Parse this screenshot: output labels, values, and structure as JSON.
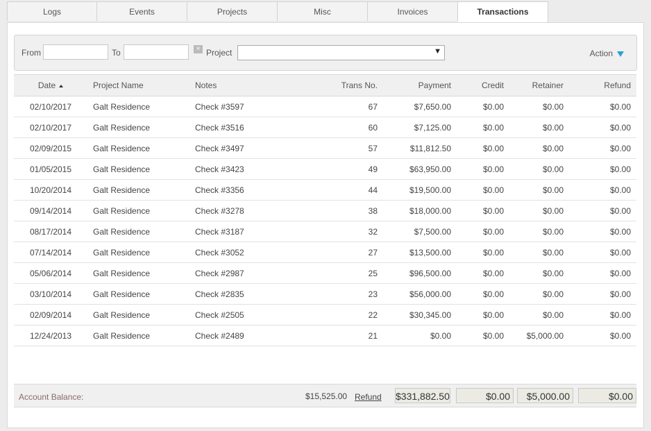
{
  "tabs": [
    {
      "label": "Logs"
    },
    {
      "label": "Events"
    },
    {
      "label": "Projects"
    },
    {
      "label": "Misc"
    },
    {
      "label": "Invoices"
    },
    {
      "label": "Transactions"
    }
  ],
  "filter": {
    "from_label": "From",
    "to_label": "To",
    "project_label": "Project",
    "from_value": "",
    "to_value": "",
    "project_value": "",
    "clear_glyph": "×",
    "action_label": "Action"
  },
  "columns": {
    "date": "Date",
    "project": "Project Name",
    "notes": "Notes",
    "trans": "Trans No.",
    "payment": "Payment",
    "credit": "Credit",
    "retainer": "Retainer",
    "refund": "Refund"
  },
  "rows": [
    {
      "date": "02/10/2017",
      "project": "Galt Residence",
      "notes": "Check #3597",
      "trans": "67",
      "payment": "$7,650.00",
      "credit": "$0.00",
      "retainer": "$0.00",
      "refund": "$0.00"
    },
    {
      "date": "02/10/2017",
      "project": "Galt Residence",
      "notes": "Check #3516",
      "trans": "60",
      "payment": "$7,125.00",
      "credit": "$0.00",
      "retainer": "$0.00",
      "refund": "$0.00"
    },
    {
      "date": "02/09/2015",
      "project": "Galt Residence",
      "notes": "Check #3497",
      "trans": "57",
      "payment": "$11,812.50",
      "credit": "$0.00",
      "retainer": "$0.00",
      "refund": "$0.00"
    },
    {
      "date": "01/05/2015",
      "project": "Galt Residence",
      "notes": "Check #3423",
      "trans": "49",
      "payment": "$63,950.00",
      "credit": "$0.00",
      "retainer": "$0.00",
      "refund": "$0.00"
    },
    {
      "date": "10/20/2014",
      "project": "Galt Residence",
      "notes": "Check #3356",
      "trans": "44",
      "payment": "$19,500.00",
      "credit": "$0.00",
      "retainer": "$0.00",
      "refund": "$0.00"
    },
    {
      "date": "09/14/2014",
      "project": "Galt Residence",
      "notes": "Check #3278",
      "trans": "38",
      "payment": "$18,000.00",
      "credit": "$0.00",
      "retainer": "$0.00",
      "refund": "$0.00"
    },
    {
      "date": "08/17/2014",
      "project": "Galt Residence",
      "notes": "Check #3187",
      "trans": "32",
      "payment": "$7,500.00",
      "credit": "$0.00",
      "retainer": "$0.00",
      "refund": "$0.00"
    },
    {
      "date": "07/14/2014",
      "project": "Galt Residence",
      "notes": "Check #3052",
      "trans": "27",
      "payment": "$13,500.00",
      "credit": "$0.00",
      "retainer": "$0.00",
      "refund": "$0.00"
    },
    {
      "date": "05/06/2014",
      "project": "Galt Residence",
      "notes": "Check #2987",
      "trans": "25",
      "payment": "$96,500.00",
      "credit": "$0.00",
      "retainer": "$0.00",
      "refund": "$0.00"
    },
    {
      "date": "03/10/2014",
      "project": "Galt Residence",
      "notes": "Check #2835",
      "trans": "23",
      "payment": "$56,000.00",
      "credit": "$0.00",
      "retainer": "$0.00",
      "refund": "$0.00"
    },
    {
      "date": "02/09/2014",
      "project": "Galt Residence",
      "notes": "Check #2505",
      "trans": "22",
      "payment": "$30,345.00",
      "credit": "$0.00",
      "retainer": "$0.00",
      "refund": "$0.00"
    },
    {
      "date": "12/24/2013",
      "project": "Galt Residence",
      "notes": "Check #2489",
      "trans": "21",
      "payment": "$0.00",
      "credit": "$0.00",
      "retainer": "$5,000.00",
      "refund": "$0.00"
    }
  ],
  "totals": {
    "label": "Account Balance:",
    "balance": "$15,525.00",
    "refund_link": "Refund",
    "payment": "$331,882.50",
    "credit": "$0.00",
    "retainer": "$5,000.00",
    "refund": "$0.00"
  },
  "colors": {
    "accent": "#2a9fd6",
    "balance_label": "#8a6b6b"
  }
}
